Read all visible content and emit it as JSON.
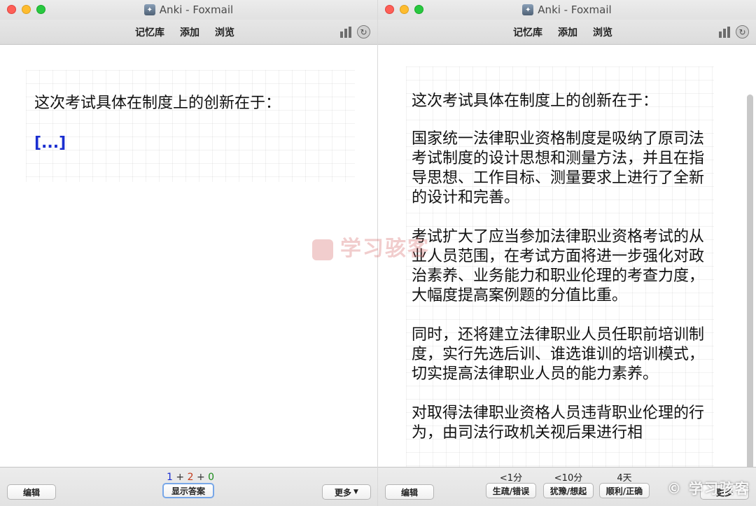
{
  "windows": {
    "left": {
      "title": "Anki - Foxmail",
      "nav": [
        "记忆库",
        "添加",
        "浏览"
      ],
      "question": "这次考试具体在制度上的创新在于：",
      "cloze": "[...]",
      "bottom": {
        "edit": "编辑",
        "counts": {
          "new": "1",
          "learn": "2",
          "review": "0",
          "plus": "+"
        },
        "show_answer": "显示答案",
        "more": "更多"
      }
    },
    "right": {
      "title": "Anki - Foxmail",
      "nav": [
        "记忆库",
        "添加",
        "浏览"
      ],
      "question": "这次考试具体在制度上的创新在于：",
      "answer": [
        "国家统一法律职业资格制度是吸纳了原司法考试制度的设计思想和测量方法，并且在指导思想、工作目标、测量要求上进行了全新的设计和完善。",
        "考试扩大了应当参加法律职业资格考试的从业人员范围，在考试方面将进一步强化对政治素养、业务能力和职业伦理的考查力度，大幅度提高案例题的分值比重。",
        "同时，还将建立法律职业人员任职前培训制度，实行先选后训、谁选谁训的培训模式，切实提高法律职业人员的能力素养。",
        "对取得法律职业资格人员违背职业伦理的行为，由司法行政机关视后果进行相"
      ],
      "bottom": {
        "edit": "编辑",
        "ease": [
          {
            "interval": "<1分",
            "label": "生疏/错误"
          },
          {
            "interval": "<10分",
            "label": "犹豫/想起"
          },
          {
            "interval": "4天",
            "label": "顺利/正确"
          }
        ],
        "more": "更多"
      }
    }
  },
  "watermark": {
    "middle": "学习骇客",
    "corner": "学习骇客"
  },
  "colors": {
    "cloze": "#1a2ed0",
    "count_new": "#1a2ed0",
    "count_learn": "#c23b1c",
    "count_review": "#1a8a1a"
  },
  "icons": {
    "stats": "stats-icon",
    "sync": "sync-icon"
  }
}
